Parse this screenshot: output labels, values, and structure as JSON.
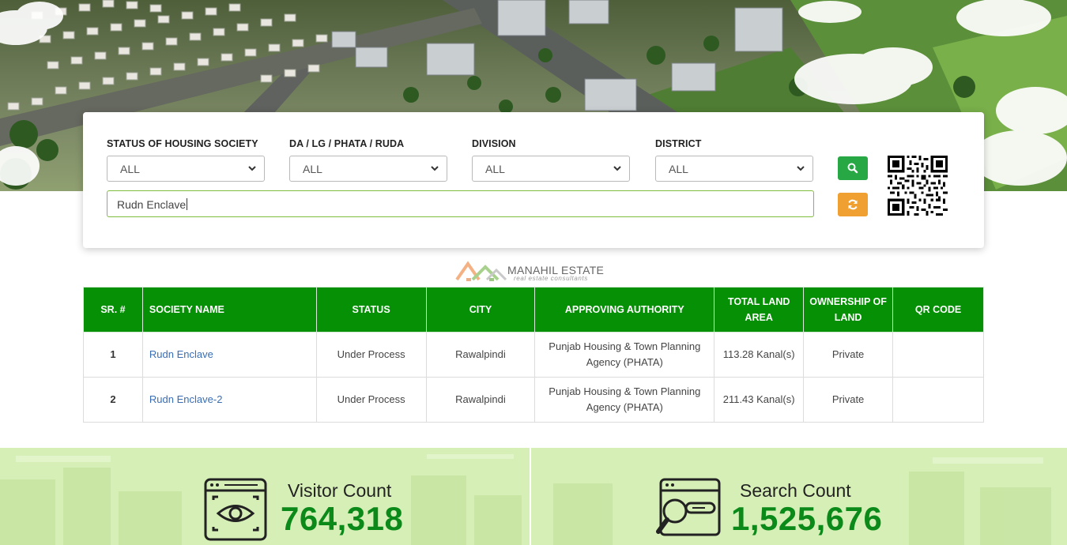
{
  "search": {
    "filters": [
      {
        "label": "STATUS OF HOUSING SOCIETY",
        "value": "ALL"
      },
      {
        "label": "DA / LG / PHATA / RUDA",
        "value": "ALL"
      },
      {
        "label": "DIVISION",
        "value": "ALL"
      },
      {
        "label": "DISTRICT",
        "value": "ALL"
      }
    ],
    "query": "Rudn Enclave",
    "search_icon": "search-icon",
    "reset_icon": "refresh-icon"
  },
  "logo": {
    "name": "MANAHIL ESTATE",
    "tagline": "real estate consultants"
  },
  "table": {
    "headers": [
      "SR. #",
      "SOCIETY NAME",
      "STATUS",
      "CITY",
      "APPROVING AUTHORITY",
      "TOTAL LAND AREA",
      "OWNERSHIP OF LAND",
      "QR CODE"
    ],
    "rows": [
      {
        "sr": "1",
        "name": "Rudn Enclave",
        "status": "Under Process",
        "city": "Rawalpindi",
        "authority": "Punjab Housing & Town Planning Agency (PHATA)",
        "area": "113.28 Kanal(s)",
        "ownership": "Private",
        "qr": ""
      },
      {
        "sr": "2",
        "name": "Rudn Enclave-2",
        "status": "Under Process",
        "city": "Rawalpindi",
        "authority": "Punjab Housing & Town Planning Agency (PHATA)",
        "area": "211.43 Kanal(s)",
        "ownership": "Private",
        "qr": ""
      }
    ]
  },
  "stats": {
    "visitor": {
      "label": "Visitor Count",
      "value": "764,318",
      "icon": "visitor-eye-icon"
    },
    "search": {
      "label": "Search Count",
      "value": "1,525,676",
      "icon": "search-count-icon"
    }
  },
  "colors": {
    "table_header": "#069006",
    "search_button": "#28a745",
    "reset_button": "#f0a030",
    "count_value": "#0b8a1a",
    "stats_bg": "#d6efb6"
  }
}
